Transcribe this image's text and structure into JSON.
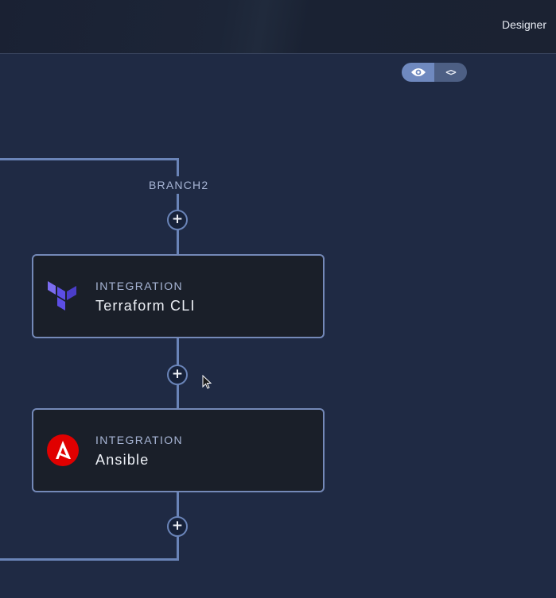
{
  "topbar": {
    "title": "Designer"
  },
  "view_toggle": {
    "preview_icon": "eye-icon",
    "code_label": "<>"
  },
  "workflow": {
    "branch_label": "BRANCH2",
    "nodes": [
      {
        "type": "INTEGRATION",
        "name": "Terraform CLI",
        "icon": "terraform-logo-icon",
        "icon_color": "#5c4ee5"
      },
      {
        "type": "INTEGRATION",
        "name": "Ansible",
        "icon": "ansible-logo-icon",
        "icon_color": "#e00000"
      }
    ],
    "add_step_icon": "plus-icon"
  },
  "colors": {
    "background": "#1f2a44",
    "connector": "#6a84b8",
    "card": "#1a1f29"
  }
}
